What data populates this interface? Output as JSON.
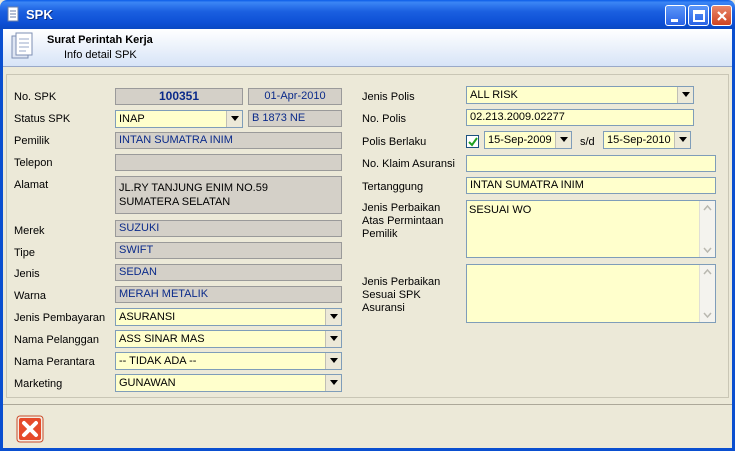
{
  "window": {
    "title": "SPK"
  },
  "header": {
    "title": "Surat Perintah Kerja",
    "subtitle": "Info detail SPK"
  },
  "left": {
    "no_spk_label": "No. SPK",
    "no_spk": "100351",
    "tanggal": "01-Apr-2010",
    "status_label": "Status SPK",
    "status": "INAP",
    "nopol": "B 1873 NE",
    "pemilik_label": "Pemilik",
    "pemilik": "INTAN SUMATRA INIM",
    "telepon_label": "Telepon",
    "telepon": "",
    "alamat_label": "Alamat",
    "alamat_1": "JL.RY TANJUNG ENIM NO.59",
    "alamat_2": "SUMATERA SELATAN",
    "merek_label": "Merek",
    "merek": "SUZUKI",
    "tipe_label": "Tipe",
    "tipe": "SWIFT",
    "jenis_label": "Jenis",
    "jenis": "SEDAN",
    "warna_label": "Warna",
    "warna": "MERAH METALIK",
    "pembayaran_label": "Jenis Pembayaran",
    "pembayaran": "ASURANSI",
    "pelanggan_label": "Nama Pelanggan",
    "pelanggan": "ASS SINAR MAS",
    "perantara_label": "Nama Perantara",
    "perantara": "-- TIDAK ADA --",
    "marketing_label": "Marketing",
    "marketing": "GUNAWAN"
  },
  "right": {
    "jenis_polis_label": "Jenis Polis",
    "jenis_polis": "ALL RISK",
    "no_polis_label": "No. Polis",
    "no_polis": "02.213.2009.02277",
    "polis_berlaku_label": "Polis Berlaku",
    "berlaku_dari": "15-Sep-2009",
    "sd": "s/d",
    "berlaku_sampai": "15-Sep-2010",
    "no_klaim_label": "No. Klaim Asuransi",
    "no_klaim": "",
    "tertanggung_label": "Tertanggung",
    "tertanggung": "INTAN SUMATRA INIM",
    "perbaikan_pemilik_label_1": "Jenis Perbaikan",
    "perbaikan_pemilik_label_2": "Atas Permintaan",
    "perbaikan_pemilik_label_3": "Pemilik",
    "perbaikan_pemilik": "SESUAI WO",
    "perbaikan_asuransi_label_1": "Jenis Perbaikan",
    "perbaikan_asuransi_label_2": "Sesuai SPK",
    "perbaikan_asuransi_label_3": "Asuransi",
    "perbaikan_asuransi": ""
  },
  "colors": {
    "title_bar": "#0a5ce8",
    "input_yellow": "#ffffcc",
    "readonly_gray": "#d4d0c8",
    "close_red": "#e03020"
  },
  "icons": {
    "app": "document-icon",
    "header": "document-stack-icon",
    "close_action": "close-x-icon"
  }
}
